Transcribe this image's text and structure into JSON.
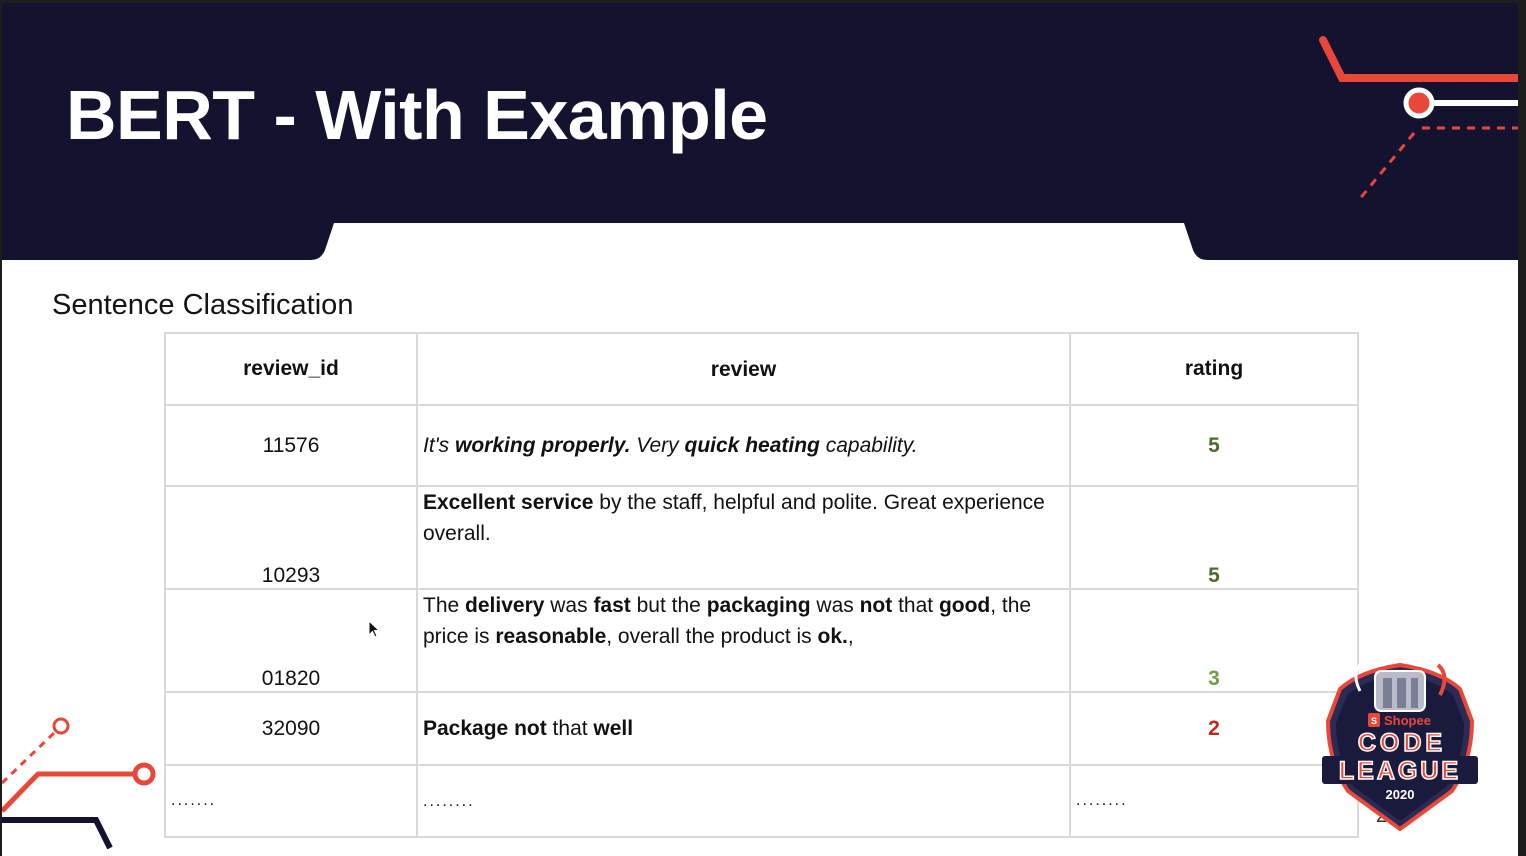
{
  "slide": {
    "title": "BERT - With Example",
    "subtitle": "Sentence Classification",
    "page_number": "24"
  },
  "colors": {
    "header_bg": "#131330",
    "accent_red": "#e8473a",
    "rating_high": "#4e6b2a",
    "rating_mid": "#6f9e45",
    "rating_low": "#c0281c"
  },
  "table": {
    "headers": [
      "review_id",
      "review",
      "rating"
    ],
    "rows": [
      {
        "review_id": "11576",
        "review_segments": [
          {
            "text": "It's ",
            "style": "i"
          },
          {
            "text": "working properly.",
            "style": "i b"
          },
          {
            "text": " Very ",
            "style": "i"
          },
          {
            "text": "quick heating",
            "style": "i b"
          },
          {
            "text": " capability.",
            "style": "i"
          }
        ],
        "rating": "5",
        "rating_color": "#4e6b2a"
      },
      {
        "review_id": "10293",
        "review_segments": [
          {
            "text": "Excellent service",
            "style": "b"
          },
          {
            "text": " by the staff, helpful and polite. Great experience overall.",
            "style": ""
          }
        ],
        "rating": "5",
        "rating_color": "#4e6b2a"
      },
      {
        "review_id": "01820",
        "review_segments": [
          {
            "text": "The ",
            "style": ""
          },
          {
            "text": "delivery",
            "style": "b"
          },
          {
            "text": " was ",
            "style": ""
          },
          {
            "text": "fast",
            "style": "b"
          },
          {
            "text": " but the ",
            "style": ""
          },
          {
            "text": "packaging",
            "style": "b"
          },
          {
            "text": " was ",
            "style": ""
          },
          {
            "text": "not",
            "style": "b"
          },
          {
            "text": " that ",
            "style": ""
          },
          {
            "text": "good",
            "style": "b"
          },
          {
            "text": ", the price is ",
            "style": ""
          },
          {
            "text": "reasonable",
            "style": "b"
          },
          {
            "text": ", overall the product is ",
            "style": ""
          },
          {
            "text": "ok.",
            "style": "b"
          },
          {
            "text": ",",
            "style": ""
          }
        ],
        "rating": "3",
        "rating_color": "#6f9e45"
      },
      {
        "review_id": "32090",
        "review_segments": [
          {
            "text": "Package not",
            "style": "b"
          },
          {
            "text": " that ",
            "style": ""
          },
          {
            "text": "well",
            "style": "b"
          }
        ],
        "rating": "2",
        "rating_color": "#c0281c"
      }
    ],
    "ellipsis_row": {
      "review_id": ".......",
      "review": "........",
      "rating": "........"
    }
  },
  "badge": {
    "brand": "Shopee",
    "line1": "CODE",
    "line2": "LEAGUE",
    "year": "2020"
  }
}
